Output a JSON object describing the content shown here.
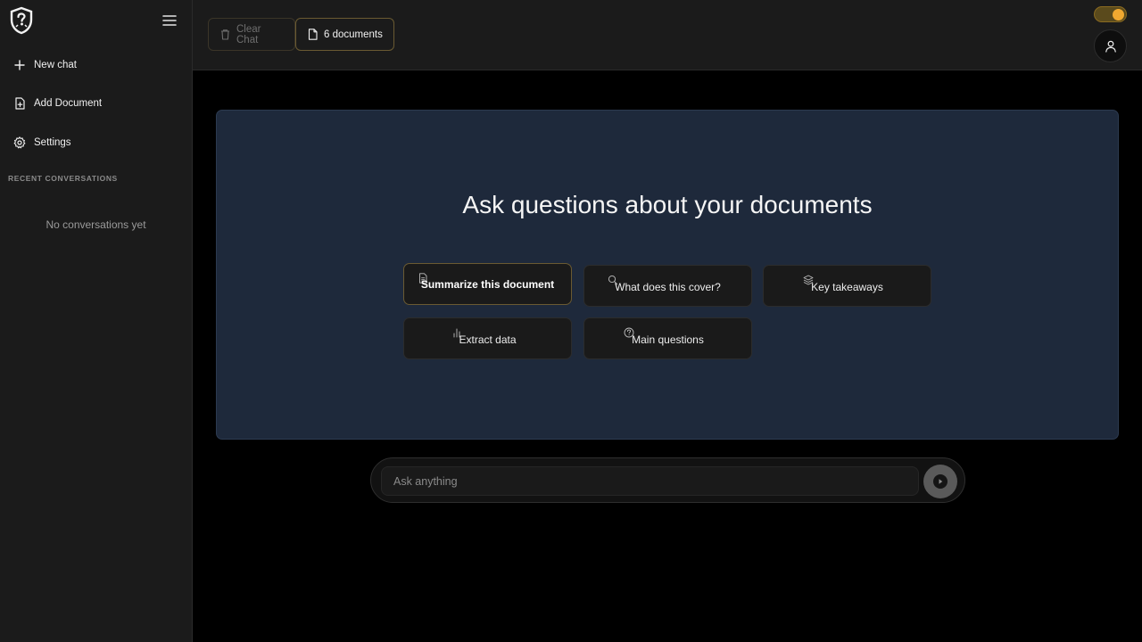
{
  "sidebar": {
    "items": [
      {
        "label": "New chat",
        "icon": "plus-icon"
      },
      {
        "label": "Add Document",
        "icon": "file-plus-icon"
      },
      {
        "label": "Settings",
        "icon": "gear-icon"
      }
    ],
    "section_label": "RECENT CONVERSATIONS",
    "empty_message": "No conversations yet"
  },
  "header": {
    "clear_label": "Clear Chat",
    "docs_label": "6 documents",
    "theme_toggle": "moon-icon"
  },
  "main": {
    "title": "Ask questions about your documents",
    "suggestions": [
      {
        "label": "Summarize this document",
        "icon": "file-text-icon",
        "active": true
      },
      {
        "label": "What does this cover?",
        "icon": "search-icon",
        "active": false
      },
      {
        "label": "Key takeaways",
        "icon": "layers-icon",
        "active": false
      },
      {
        "label": "Extract data",
        "icon": "bar-chart-icon",
        "active": false
      },
      {
        "label": "Main questions",
        "icon": "help-circle-icon",
        "active": false
      }
    ]
  },
  "input": {
    "placeholder": "Ask anything",
    "value": ""
  },
  "colors": {
    "accent": "#f0a830",
    "panel_bg": "#1e293b",
    "sidebar_bg": "#1b1b1b"
  }
}
